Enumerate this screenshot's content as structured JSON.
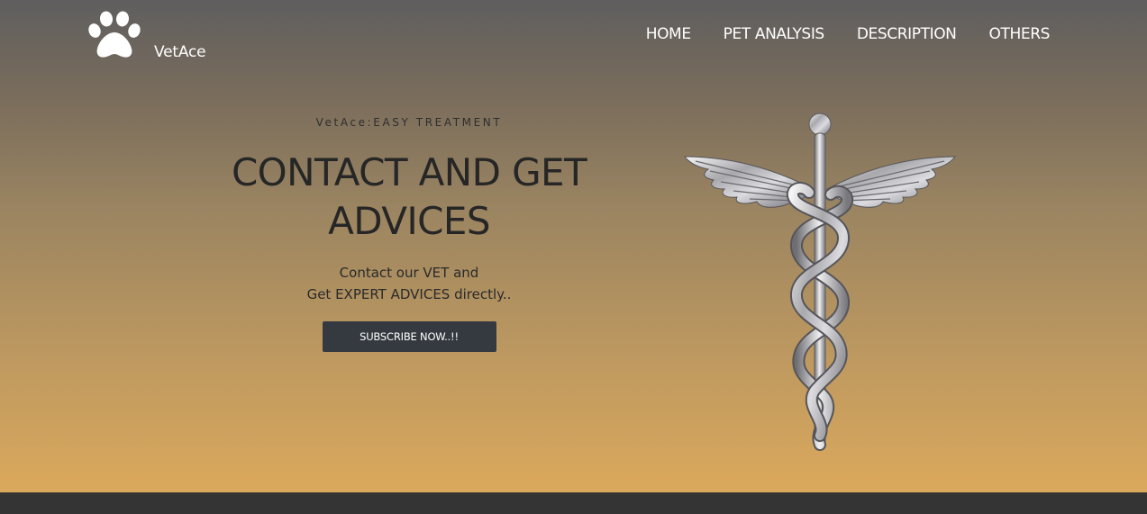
{
  "header": {
    "brand": "VetAce",
    "logo_icon": "paw-icon",
    "nav": [
      {
        "label": "HOME"
      },
      {
        "label": "PET ANALYSIS"
      },
      {
        "label": "DESCRIPTION"
      },
      {
        "label": "OTHERS"
      }
    ]
  },
  "hero": {
    "tagline": "VetAce:EASY TREATMENT",
    "headline_line1": "CONTACT AND GET",
    "headline_line2": "ADVICES",
    "description_line1": "Contact our VET and",
    "description_line2": "Get EXPERT ADVICES directly..",
    "cta_label": "SUBSCRIBE NOW..!!",
    "image": "caduceus-image"
  },
  "colors": {
    "gradient_top": "#5f5e5e",
    "gradient_bottom": "#dba95c",
    "button_bg": "#343a40",
    "footer_bar": "#343434"
  }
}
